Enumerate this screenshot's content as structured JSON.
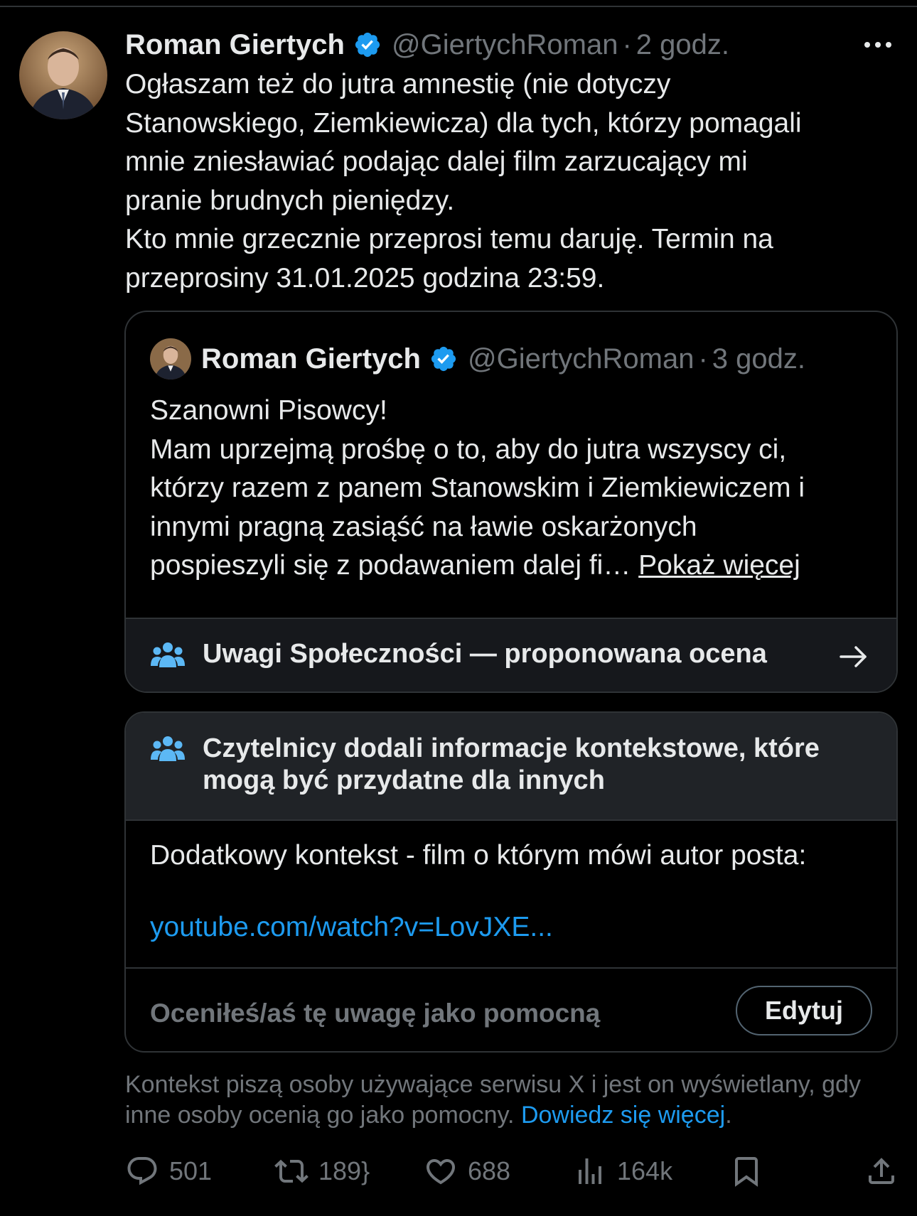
{
  "tweet": {
    "author_name": "Roman Giertych",
    "handle": "@GiertychRoman",
    "separator": "·",
    "time": "2 godz.",
    "text": "Ogłaszam też do jutra amnestię (nie dotyczy\nStanowskiego, Ziemkiewicza) dla tych, którzy pomagali\nmnie zniesławiać podając dalej film zarzucający mi\npranie brudnych pieniędzy.\nKto mnie grzecznie przeprosi temu daruję. Termin na\nprzeprosiny 31.01.2025 godzina 23:59."
  },
  "quoted": {
    "author_name": "Roman Giertych",
    "handle": "@GiertychRoman",
    "separator": "·",
    "time": "3 godz.",
    "text": "Szanowni Pisowcy!\nMam uprzejmą prośbę o to, aby do jutra wszyscy ci,\nktórzy razem z panem Stanowskim i Ziemkiewiczem i\ninnymi pragną zasiąść na ławie oskarżonych\npospieszyli się z podawaniem dalej fi… ",
    "show_more": "Pokaż więcej",
    "community_note_label": "Uwagi Społeczności — proponowana ocena"
  },
  "community_note": {
    "title": "Czytelnicy dodali informacje kontekstowe, które mogą być przydatne dla innych",
    "body": "Dodatkowy kontekst - film o którym mówi autor posta:",
    "link": "youtube.com/watch?v=LovJXE...",
    "rated_text": "Oceniłeś/aś tę uwagę jako pomocną",
    "edit_label": "Edytuj"
  },
  "footer_note": {
    "text": "Kontekst piszą osoby używające serwisu X i jest on wyświetlany, gdy inne osoby ocenią go jako pomocny. ",
    "learn_more": "Dowiedz się więcej",
    "period": "."
  },
  "actions": {
    "replies": "501",
    "reposts": "189",
    "likes": "688",
    "views": "164k"
  },
  "colors": {
    "background": "#000000",
    "text": "#e7e9ea",
    "muted": "#71767b",
    "accent": "#1d9bf0",
    "border": "#2f3336",
    "note_icon": "#5cb8f5"
  },
  "icons": [
    "verified-badge-icon",
    "more-icon",
    "people-icon",
    "arrow-right-icon",
    "reply-icon",
    "repost-icon",
    "like-icon",
    "views-icon",
    "bookmark-icon",
    "share-icon"
  ]
}
